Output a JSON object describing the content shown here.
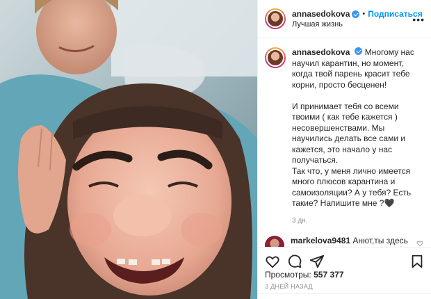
{
  "header": {
    "username": "annasedokova",
    "dot": "•",
    "follow_label": "Подписаться",
    "location": "Лучшая жизнь"
  },
  "caption": {
    "username": "annasedokova",
    "text": "Многому нас научил карантин, но момент, когда твой парень красит тебе корни, просто бесценен!\n\nИ принимает тебя со всеми твоими ( как тебе кажется ) несовершенствами. Мы научились делать все сами и кажется, это начало у нас получаться.\nТак что, у меня лично имеется много плюсов карантина и самоизоляции? А у тебя? Есть такие? Напишите мне ?🖤",
    "time": "3 дн."
  },
  "comments": [
    {
      "username": "markelova9481",
      "text": "Анют,ты здесь такая красивая,как никогда😂😂😂"
    }
  ],
  "stats": {
    "views_label": "Просмотры:",
    "views_value": "557 377",
    "date": "3 дней назад"
  },
  "icons": [
    "more-icon",
    "heart-icon",
    "comment-icon",
    "share-icon",
    "save-icon",
    "verified-icon"
  ],
  "colors": {
    "accent": "#0095f6",
    "verified": "#3897f0",
    "muted": "#8e8e8e"
  }
}
